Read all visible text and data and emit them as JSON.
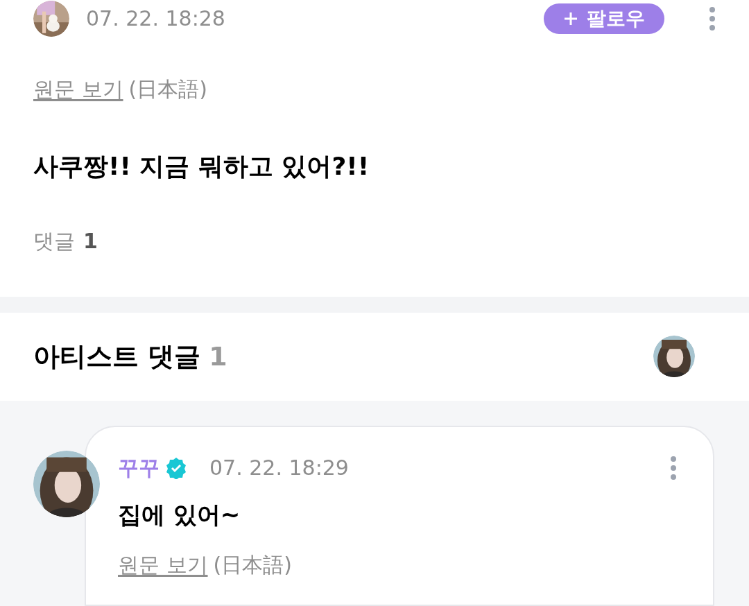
{
  "post": {
    "time": "07. 22. 18:28",
    "follow_button": "팔로우",
    "translation_link": "원문 보기",
    "translation_lang": "(日本語)",
    "body": "사쿠짱!! 지금 뭐하고 있어?!!",
    "comments_label": "댓글",
    "comments_count": "1"
  },
  "artist_comments": {
    "title": "아티스트 댓글",
    "count": "1",
    "items": [
      {
        "name": "꾸꾸",
        "verified": true,
        "time": "07. 22. 18:29",
        "body": "집에 있어~",
        "translation_link": "원문 보기",
        "translation_lang": "(日本語)"
      }
    ]
  }
}
